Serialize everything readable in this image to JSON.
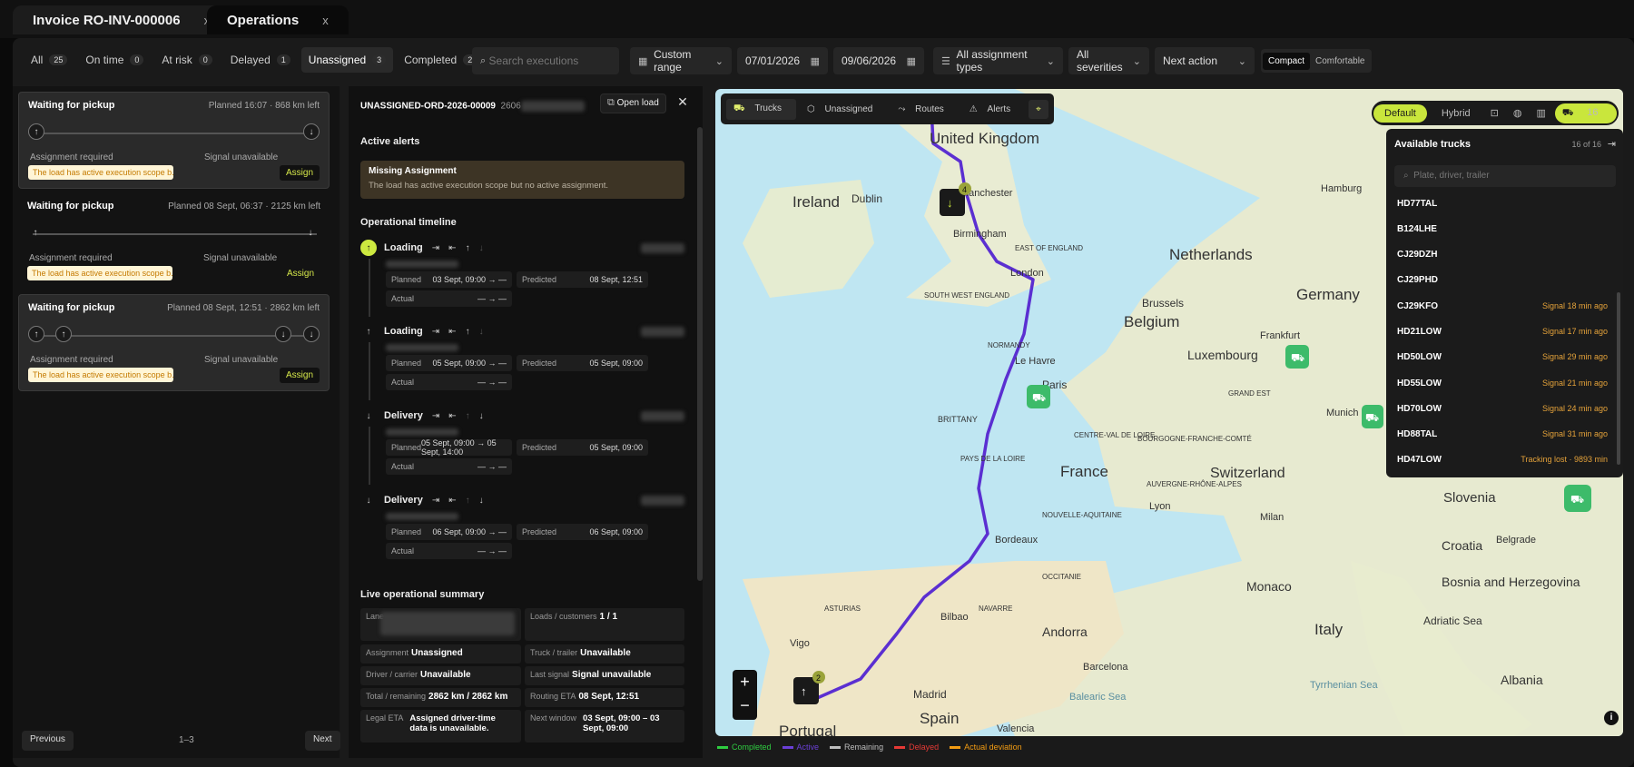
{
  "tabs": [
    {
      "label": "Invoice RO-INV-000006",
      "close": "x"
    },
    {
      "label": "Operations",
      "close": "x"
    }
  ],
  "filters": {
    "chips": [
      {
        "label": "All",
        "count": "25"
      },
      {
        "label": "On time",
        "count": "0"
      },
      {
        "label": "At risk",
        "count": "0"
      },
      {
        "label": "Delayed",
        "count": "1"
      },
      {
        "label": "Unassigned",
        "count": "3"
      },
      {
        "label": "Completed",
        "count": "21"
      }
    ],
    "search_placeholder": "Search executions",
    "range": "Custom range",
    "date_from": "07/01/2026",
    "date_to": "09/06/2026",
    "assignment": "All assignment types",
    "severity": "All severities",
    "next_action": "Next action",
    "density_compact": "Compact",
    "density_comfortable": "Comfortable"
  },
  "list": {
    "cards": [
      {
        "title": "Waiting for pickup",
        "planned": "Planned 16:07 · 868 km left",
        "assignment": "Assignment required",
        "signal": "Signal unavailable",
        "warning": "The load has active execution scope b...",
        "action": "Assign"
      },
      {
        "title": "Waiting for pickup",
        "planned": "Planned 08 Sept, 06:37 · 2125 km left",
        "assignment": "Assignment required",
        "signal": "Signal unavailable",
        "warning": "The load has active execution scope b...",
        "action": "Assign"
      },
      {
        "title": "Waiting for pickup",
        "planned": "Planned 08 Sept, 12:51 · 2862 km left",
        "assignment": "Assignment required",
        "signal": "Signal unavailable",
        "warning": "The load has active execution scope b...",
        "action": "Assign"
      }
    ],
    "prev": "Previous",
    "range": "1–3",
    "next": "Next"
  },
  "detail": {
    "order": "UNASSIGNED-ORD-2026-00009",
    "order_suffix": "2606",
    "open_load": "Open load",
    "close": "✕",
    "active_alerts": "Active alerts",
    "alert_title": "Missing Assignment",
    "alert_body": "The load has active execution scope but no active assignment.",
    "timeline_title": "Operational timeline",
    "stops": [
      {
        "name": "Loading",
        "planned_label": "Planned",
        "planned": "03 Sept, 09:00 → —",
        "predicted_label": "Predicted",
        "predicted": "08 Sept, 12:51",
        "actual_label": "Actual",
        "actual": "— → —"
      },
      {
        "name": "Loading",
        "planned_label": "Planned",
        "planned": "05 Sept, 09:00 → —",
        "predicted_label": "Predicted",
        "predicted": "05 Sept, 09:00",
        "actual_label": "Actual",
        "actual": "— → —"
      },
      {
        "name": "Delivery",
        "planned_label": "Planned",
        "planned": "05 Sept, 09:00 → 05 Sept, 14:00",
        "predicted_label": "Predicted",
        "predicted": "05 Sept, 09:00",
        "actual_label": "Actual",
        "actual": "— → —"
      },
      {
        "name": "Delivery",
        "planned_label": "Planned",
        "planned": "06 Sept, 09:00 → —",
        "predicted_label": "Predicted",
        "predicted": "06 Sept, 09:00",
        "actual_label": "Actual",
        "actual": "— → —"
      }
    ],
    "summary_title": "Live operational summary",
    "summary": {
      "lane_label": "Lane",
      "loads_label": "Loads / customers",
      "loads": "1 / 1",
      "assignment_label": "Assignment",
      "assignment": "Unassigned",
      "truck_label": "Truck / trailer",
      "truck": "Unavailable",
      "driver_label": "Driver / carrier",
      "driver": "Unavailable",
      "signal_label": "Last signal",
      "signal": "Signal unavailable",
      "total_label": "Total / remaining",
      "total": "2862 km / 2862 km",
      "routing_label": "Routing ETA",
      "routing": "08 Sept, 12:51",
      "legal_label": "Legal ETA",
      "legal": "Assigned driver-time data is unavailable.",
      "window_label": "Next window",
      "window": "03 Sept, 09:00 – 03 Sept, 09:00"
    }
  },
  "map": {
    "tools": [
      "Trucks",
      "Unassigned",
      "Routes",
      "Alerts"
    ],
    "views": [
      "Default",
      "Hybrid"
    ],
    "truck_count": "16",
    "panel_title": "Available trucks",
    "panel_count": "16 of 16",
    "panel_search": "Plate, driver, trailer",
    "trucks": [
      {
        "plate": "HD77TAL",
        "status": ""
      },
      {
        "plate": "B124LHE",
        "status": ""
      },
      {
        "plate": "CJ29DZH",
        "status": ""
      },
      {
        "plate": "CJ29PHD",
        "status": ""
      },
      {
        "plate": "CJ29KFO",
        "status": "Signal 18 min ago"
      },
      {
        "plate": "HD21LOW",
        "status": "Signal 17 min ago"
      },
      {
        "plate": "HD50LOW",
        "status": "Signal 29 min ago"
      },
      {
        "plate": "HD55LOW",
        "status": "Signal 21 min ago"
      },
      {
        "plate": "HD70LOW",
        "status": "Signal 24 min ago"
      },
      {
        "plate": "HD88TAL",
        "status": "Signal 31 min ago"
      },
      {
        "plate": "HD47LOW",
        "status": "Tracking lost · 9893 min"
      }
    ],
    "places": [
      "United Kingdom",
      "Ireland",
      "Dublin",
      "Birmingham",
      "London",
      "Manchester",
      "EAST OF ENGLAND",
      "SOUTH WEST ENGLAND",
      "Netherlands",
      "Brussels",
      "Belgium",
      "Luxembourg",
      "Germany",
      "Hamburg",
      "Frankfurt",
      "Munich",
      "Le Havre",
      "Paris",
      "BRITTANY",
      "PAYS DE LA LOIRE",
      "CENTRE-VAL DE LOIRE",
      "France",
      "Switzerland",
      "Lyon",
      "Bordeaux",
      "Milan",
      "Slovenia",
      "Croatia",
      "Belgrade",
      "Monaco",
      "Bosnia and Herzegovina",
      "Italy",
      "Adriatic Sea",
      "Andorra",
      "Barcelona",
      "Bilbao",
      "Vigo",
      "Spain",
      "Madrid",
      "Valencia",
      "Portugal",
      "Balearic Sea",
      "Tyrrhenian Sea",
      "Albania",
      "ASTURIAS",
      "NAVARRE",
      "NORMANDY",
      "GRAND EST",
      "BOURGOGNE-FRANCHE-COMTÉ",
      "NOUVELLE-AQUITAINE",
      "OCCITANIE",
      "AUVERGNE-RHÔNE-ALPES"
    ],
    "stop_badges": [
      "4",
      "2"
    ],
    "zoom_in": "+",
    "zoom_out": "−",
    "legend": [
      {
        "label": "Completed",
        "color": "#2ecc40"
      },
      {
        "label": "Active",
        "color": "#6a3fd6"
      },
      {
        "label": "Remaining",
        "color": "#bdbdbd"
      },
      {
        "label": "Delayed",
        "color": "#e53935"
      },
      {
        "label": "Actual deviation",
        "color": "#f39c12"
      }
    ]
  }
}
